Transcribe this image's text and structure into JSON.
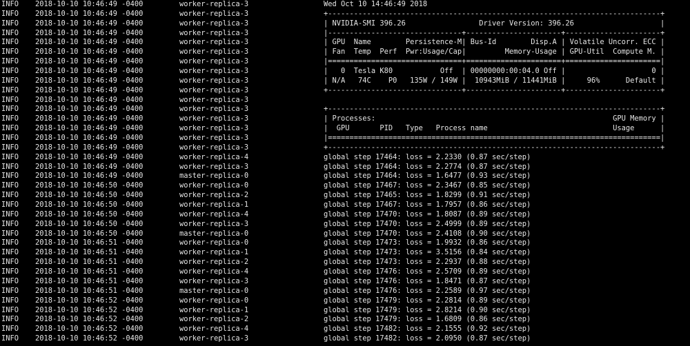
{
  "terminal": {
    "colors": {
      "background": "#000000",
      "foreground": "#e6e6e6"
    },
    "lines": [
      {
        "level": "INFO",
        "timestamp": "2018-10-10 10:46:49 -0400",
        "source": "worker-replica-3",
        "message": "Wed Oct 10 14:46:49 2018"
      },
      {
        "level": "INFO",
        "timestamp": "2018-10-10 10:46:49 -0400",
        "source": "worker-replica-3",
        "message": "+-----------------------------------------------------------------------------+"
      },
      {
        "level": "INFO",
        "timestamp": "2018-10-10 10:46:49 -0400",
        "source": "worker-replica-3",
        "message": "| NVIDIA-SMI 396.26                 Driver Version: 396.26                    |"
      },
      {
        "level": "INFO",
        "timestamp": "2018-10-10 10:46:49 -0400",
        "source": "worker-replica-3",
        "message": "|-------------------------------+----------------------+----------------------+"
      },
      {
        "level": "INFO",
        "timestamp": "2018-10-10 10:46:49 -0400",
        "source": "worker-replica-3",
        "message": "| GPU  Name        Persistence-M| Bus-Id        Disp.A | Volatile Uncorr. ECC |"
      },
      {
        "level": "INFO",
        "timestamp": "2018-10-10 10:46:49 -0400",
        "source": "worker-replica-3",
        "message": "| Fan  Temp  Perf  Pwr:Usage/Cap|         Memory-Usage | GPU-Util  Compute M. |"
      },
      {
        "level": "INFO",
        "timestamp": "2018-10-10 10:46:49 -0400",
        "source": "worker-replica-3",
        "message": "|===============================+======================+======================|"
      },
      {
        "level": "INFO",
        "timestamp": "2018-10-10 10:46:49 -0400",
        "source": "worker-replica-3",
        "message": "|   0  Tesla K80           Off  | 00000000:00:04.0 Off |                    0 |"
      },
      {
        "level": "INFO",
        "timestamp": "2018-10-10 10:46:49 -0400",
        "source": "worker-replica-3",
        "message": "| N/A   74C    P0   135W / 149W |  10943MiB / 11441MiB |     96%      Default |"
      },
      {
        "level": "INFO",
        "timestamp": "2018-10-10 10:46:49 -0400",
        "source": "worker-replica-3",
        "message": "+-------------------------------+----------------------+----------------------+"
      },
      {
        "level": "INFO",
        "timestamp": "2018-10-10 10:46:49 -0400",
        "source": "worker-replica-3",
        "message": ""
      },
      {
        "level": "INFO",
        "timestamp": "2018-10-10 10:46:49 -0400",
        "source": "worker-replica-3",
        "message": "+-----------------------------------------------------------------------------+"
      },
      {
        "level": "INFO",
        "timestamp": "2018-10-10 10:46:49 -0400",
        "source": "worker-replica-3",
        "message": "| Processes:                                                       GPU Memory |"
      },
      {
        "level": "INFO",
        "timestamp": "2018-10-10 10:46:49 -0400",
        "source": "worker-replica-3",
        "message": "|  GPU       PID   Type   Process name                             Usage      |"
      },
      {
        "level": "INFO",
        "timestamp": "2018-10-10 10:46:49 -0400",
        "source": "worker-replica-3",
        "message": "|=============================================================================|"
      },
      {
        "level": "INFO",
        "timestamp": "2018-10-10 10:46:49 -0400",
        "source": "worker-replica-3",
        "message": "+-----------------------------------------------------------------------------+"
      },
      {
        "level": "INFO",
        "timestamp": "2018-10-10 10:46:49 -0400",
        "source": "worker-replica-4",
        "message": "global step 17464: loss = 2.2330 (0.87 sec/step)"
      },
      {
        "level": "INFO",
        "timestamp": "2018-10-10 10:46:49 -0400",
        "source": "worker-replica-3",
        "message": "global step 17464: loss = 2.2774 (0.87 sec/step)"
      },
      {
        "level": "INFO",
        "timestamp": "2018-10-10 10:46:49 -0400",
        "source": "master-replica-0",
        "message": "global step 17464: loss = 1.6477 (0.93 sec/step)"
      },
      {
        "level": "INFO",
        "timestamp": "2018-10-10 10:46:50 -0400",
        "source": "worker-replica-0",
        "message": "global step 17467: loss = 2.3467 (0.85 sec/step)"
      },
      {
        "level": "INFO",
        "timestamp": "2018-10-10 10:46:50 -0400",
        "source": "worker-replica-2",
        "message": "global step 17465: loss = 1.8299 (0.91 sec/step)"
      },
      {
        "level": "INFO",
        "timestamp": "2018-10-10 10:46:50 -0400",
        "source": "worker-replica-1",
        "message": "global step 17467: loss = 1.7957 (0.86 sec/step)"
      },
      {
        "level": "INFO",
        "timestamp": "2018-10-10 10:46:50 -0400",
        "source": "worker-replica-4",
        "message": "global step 17470: loss = 1.8087 (0.89 sec/step)"
      },
      {
        "level": "INFO",
        "timestamp": "2018-10-10 10:46:50 -0400",
        "source": "worker-replica-3",
        "message": "global step 17470: loss = 2.4999 (0.89 sec/step)"
      },
      {
        "level": "INFO",
        "timestamp": "2018-10-10 10:46:50 -0400",
        "source": "master-replica-0",
        "message": "global step 17470: loss = 2.4108 (0.90 sec/step)"
      },
      {
        "level": "INFO",
        "timestamp": "2018-10-10 10:46:51 -0400",
        "source": "worker-replica-0",
        "message": "global step 17473: loss = 1.9932 (0.86 sec/step)"
      },
      {
        "level": "INFO",
        "timestamp": "2018-10-10 10:46:51 -0400",
        "source": "worker-replica-1",
        "message": "global step 17473: loss = 3.5156 (0.84 sec/step)"
      },
      {
        "level": "INFO",
        "timestamp": "2018-10-10 10:46:51 -0400",
        "source": "worker-replica-2",
        "message": "global step 17473: loss = 2.2937 (0.88 sec/step)"
      },
      {
        "level": "INFO",
        "timestamp": "2018-10-10 10:46:51 -0400",
        "source": "worker-replica-4",
        "message": "global step 17476: loss = 2.5709 (0.89 sec/step)"
      },
      {
        "level": "INFO",
        "timestamp": "2018-10-10 10:46:51 -0400",
        "source": "worker-replica-3",
        "message": "global step 17476: loss = 1.8471 (0.87 sec/step)"
      },
      {
        "level": "INFO",
        "timestamp": "2018-10-10 10:46:51 -0400",
        "source": "master-replica-0",
        "message": "global step 17476: loss = 2.2589 (0.97 sec/step)"
      },
      {
        "level": "INFO",
        "timestamp": "2018-10-10 10:46:52 -0400",
        "source": "worker-replica-0",
        "message": "global step 17479: loss = 2.2814 (0.89 sec/step)"
      },
      {
        "level": "INFO",
        "timestamp": "2018-10-10 10:46:52 -0400",
        "source": "worker-replica-1",
        "message": "global step 17479: loss = 2.8214 (0.90 sec/step)"
      },
      {
        "level": "INFO",
        "timestamp": "2018-10-10 10:46:52 -0400",
        "source": "worker-replica-2",
        "message": "global step 17479: loss = 1.6809 (0.86 sec/step)"
      },
      {
        "level": "INFO",
        "timestamp": "2018-10-10 10:46:52 -0400",
        "source": "worker-replica-4",
        "message": "global step 17482: loss = 2.1555 (0.92 sec/step)"
      },
      {
        "level": "INFO",
        "timestamp": "2018-10-10 10:46:52 -0400",
        "source": "worker-replica-3",
        "message": "global step 17482: loss = 2.0950 (0.87 sec/step)"
      }
    ]
  }
}
